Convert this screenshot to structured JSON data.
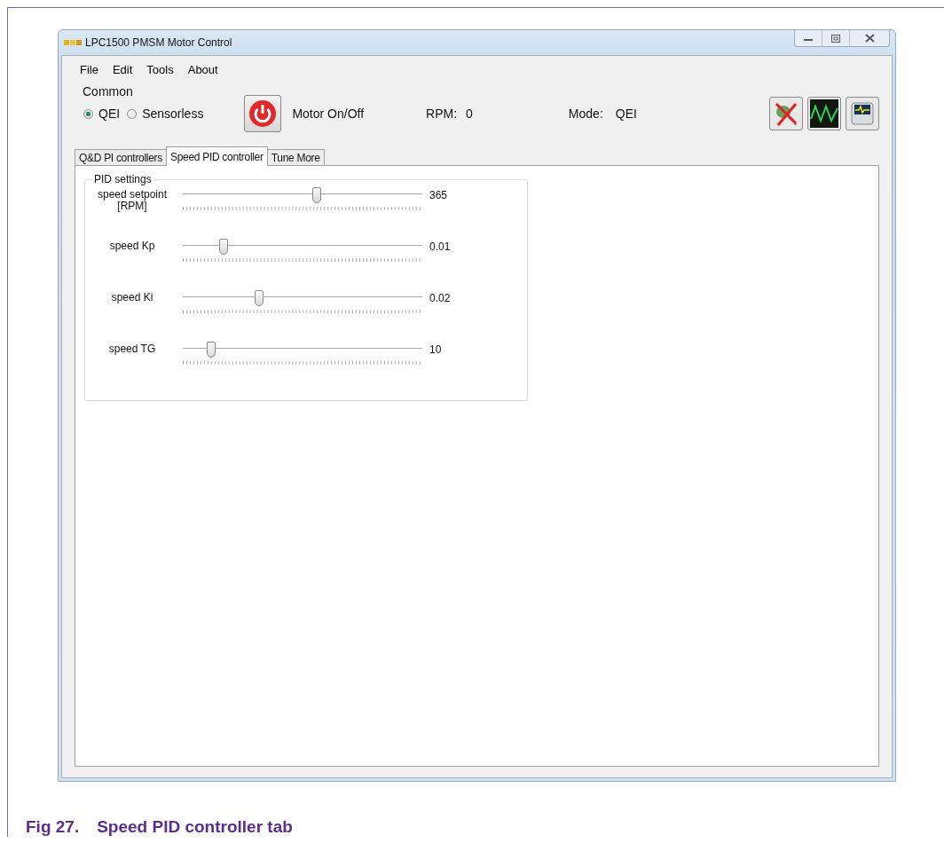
{
  "window": {
    "title": "LPC1500 PMSM Motor Control"
  },
  "menu": [
    "File",
    "Edit",
    "Tools",
    "About"
  ],
  "common": {
    "title": "Common",
    "modes": [
      {
        "label": "QEI",
        "selected": true
      },
      {
        "label": "Sensorless",
        "selected": false
      }
    ],
    "motor_label": "Motor On/Off",
    "rpm_label": "RPM:",
    "rpm_value": "0",
    "mode_label": "Mode:",
    "mode_value": "QEI"
  },
  "tabs": [
    {
      "label": "Q&D PI controllers",
      "selected": false
    },
    {
      "label": "Speed PID controller",
      "selected": true
    },
    {
      "label": "Tune More",
      "selected": false
    }
  ],
  "pid_settings": {
    "title": "PID settings",
    "sliders": [
      {
        "label": "speed setpoint [RPM]",
        "level": 0.56,
        "value": "365"
      },
      {
        "label": "speed Kp",
        "level": 0.17,
        "value": "0.01"
      },
      {
        "label": "speed Ki",
        "level": 0.32,
        "value": "0.02"
      },
      {
        "label": "speed TG",
        "level": 0.12,
        "value": "10"
      }
    ]
  },
  "caption": {
    "number": "Fig 27.",
    "title": "Speed PID controller tab"
  }
}
